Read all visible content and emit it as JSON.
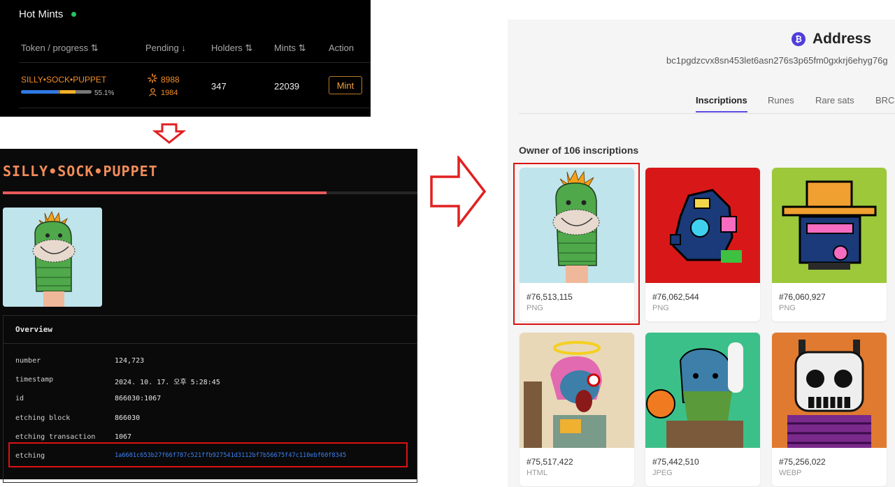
{
  "hot_mints": {
    "title": "Hot Mints",
    "headers": {
      "token": "Token / progress ⇅",
      "pending": "Pending ↓",
      "holders": "Holders ⇅",
      "mints": "Mints ⇅",
      "action": "Action"
    },
    "row": {
      "token": "SILLY•SOCK•PUPPET",
      "progress_pct": "55.1%",
      "progress_value": 0.551,
      "pending": "8988",
      "pending_users": "1984",
      "holders": "347",
      "mints": "22039",
      "action": "Mint"
    }
  },
  "rune": {
    "name": "SILLY•SOCK•PUPPET",
    "progress_value": 0.781,
    "overview_title": "Overview",
    "fields": [
      {
        "key": "number",
        "value": "124,723"
      },
      {
        "key": "timestamp",
        "value": "2024. 10. 17. 오후 5:28:45"
      },
      {
        "key": "id",
        "value": "866030:1067"
      },
      {
        "key": "etching block",
        "value": "866030"
      },
      {
        "key": "etching transaction",
        "value": "1067"
      },
      {
        "key": "etching",
        "value": "1a6601c653b27f66f787c521ffb927541d3112bf7b56675f47c110ebf60f8345"
      }
    ]
  },
  "address": {
    "title": "Address",
    "hash": "bc1pgdzcvx8sn453let6asn276s3p65fm0gxkrj6ehyg76g",
    "tabs": [
      "Inscriptions",
      "Runes",
      "Rare sats",
      "BRC-"
    ],
    "owner": "Owner of 106 inscriptions",
    "cards": [
      {
        "number": "#76,513,115",
        "type": "PNG",
        "bg": "#bfe4eb"
      },
      {
        "number": "#76,062,544",
        "type": "PNG",
        "bg": "#d81818"
      },
      {
        "number": "#76,060,927",
        "type": "PNG",
        "bg": "#9cc83a"
      },
      {
        "number": "#75,517,422",
        "type": "HTML",
        "bg": "#e8d8b8"
      },
      {
        "number": "#75,442,510",
        "type": "JPEG",
        "bg": "#3cc08a"
      },
      {
        "number": "#75,256,022",
        "type": "WEBP",
        "bg": "#e07a30"
      }
    ]
  },
  "colors": {
    "accent_orange": "#f28c28",
    "brand_purple": "#5b4be3",
    "highlight_red": "#d11"
  }
}
